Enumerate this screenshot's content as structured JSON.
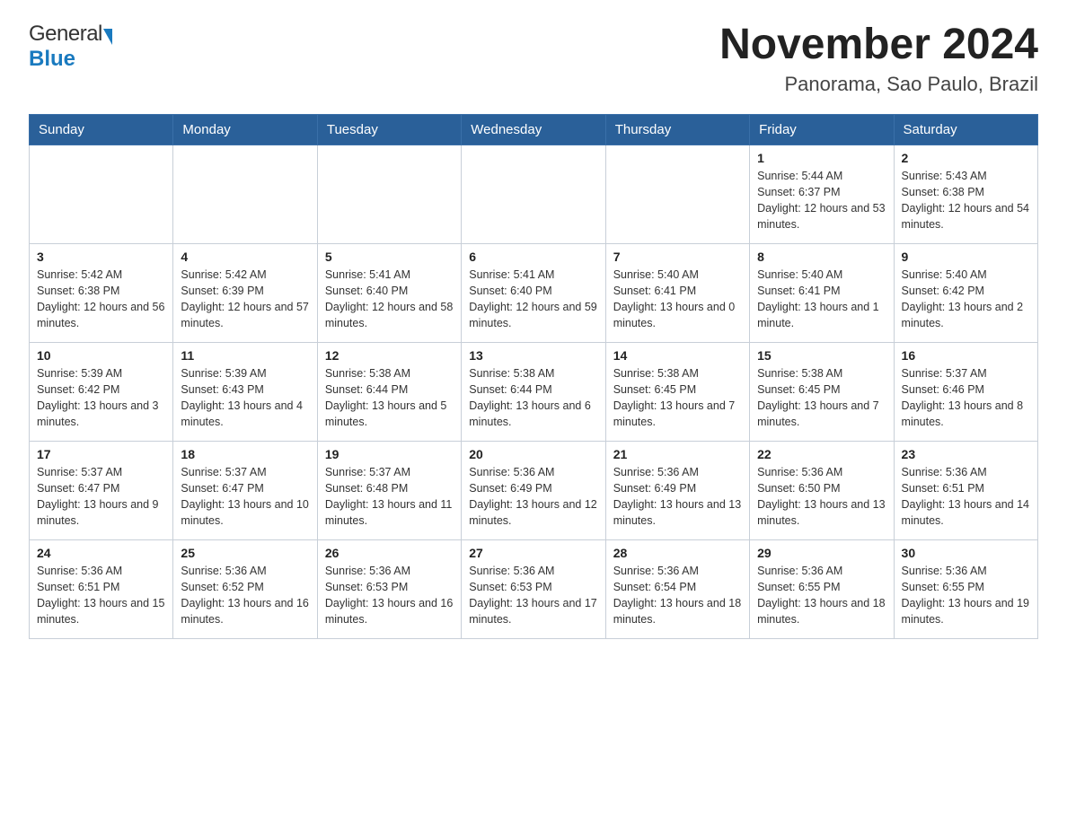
{
  "header": {
    "logo_general": "General",
    "logo_blue": "Blue",
    "title": "November 2024",
    "subtitle": "Panorama, Sao Paulo, Brazil"
  },
  "days_of_week": [
    "Sunday",
    "Monday",
    "Tuesday",
    "Wednesday",
    "Thursday",
    "Friday",
    "Saturday"
  ],
  "weeks": [
    [
      {
        "day": "",
        "info": ""
      },
      {
        "day": "",
        "info": ""
      },
      {
        "day": "",
        "info": ""
      },
      {
        "day": "",
        "info": ""
      },
      {
        "day": "",
        "info": ""
      },
      {
        "day": "1",
        "info": "Sunrise: 5:44 AM\nSunset: 6:37 PM\nDaylight: 12 hours and 53 minutes."
      },
      {
        "day": "2",
        "info": "Sunrise: 5:43 AM\nSunset: 6:38 PM\nDaylight: 12 hours and 54 minutes."
      }
    ],
    [
      {
        "day": "3",
        "info": "Sunrise: 5:42 AM\nSunset: 6:38 PM\nDaylight: 12 hours and 56 minutes."
      },
      {
        "day": "4",
        "info": "Sunrise: 5:42 AM\nSunset: 6:39 PM\nDaylight: 12 hours and 57 minutes."
      },
      {
        "day": "5",
        "info": "Sunrise: 5:41 AM\nSunset: 6:40 PM\nDaylight: 12 hours and 58 minutes."
      },
      {
        "day": "6",
        "info": "Sunrise: 5:41 AM\nSunset: 6:40 PM\nDaylight: 12 hours and 59 minutes."
      },
      {
        "day": "7",
        "info": "Sunrise: 5:40 AM\nSunset: 6:41 PM\nDaylight: 13 hours and 0 minutes."
      },
      {
        "day": "8",
        "info": "Sunrise: 5:40 AM\nSunset: 6:41 PM\nDaylight: 13 hours and 1 minute."
      },
      {
        "day": "9",
        "info": "Sunrise: 5:40 AM\nSunset: 6:42 PM\nDaylight: 13 hours and 2 minutes."
      }
    ],
    [
      {
        "day": "10",
        "info": "Sunrise: 5:39 AM\nSunset: 6:42 PM\nDaylight: 13 hours and 3 minutes."
      },
      {
        "day": "11",
        "info": "Sunrise: 5:39 AM\nSunset: 6:43 PM\nDaylight: 13 hours and 4 minutes."
      },
      {
        "day": "12",
        "info": "Sunrise: 5:38 AM\nSunset: 6:44 PM\nDaylight: 13 hours and 5 minutes."
      },
      {
        "day": "13",
        "info": "Sunrise: 5:38 AM\nSunset: 6:44 PM\nDaylight: 13 hours and 6 minutes."
      },
      {
        "day": "14",
        "info": "Sunrise: 5:38 AM\nSunset: 6:45 PM\nDaylight: 13 hours and 7 minutes."
      },
      {
        "day": "15",
        "info": "Sunrise: 5:38 AM\nSunset: 6:45 PM\nDaylight: 13 hours and 7 minutes."
      },
      {
        "day": "16",
        "info": "Sunrise: 5:37 AM\nSunset: 6:46 PM\nDaylight: 13 hours and 8 minutes."
      }
    ],
    [
      {
        "day": "17",
        "info": "Sunrise: 5:37 AM\nSunset: 6:47 PM\nDaylight: 13 hours and 9 minutes."
      },
      {
        "day": "18",
        "info": "Sunrise: 5:37 AM\nSunset: 6:47 PM\nDaylight: 13 hours and 10 minutes."
      },
      {
        "day": "19",
        "info": "Sunrise: 5:37 AM\nSunset: 6:48 PM\nDaylight: 13 hours and 11 minutes."
      },
      {
        "day": "20",
        "info": "Sunrise: 5:36 AM\nSunset: 6:49 PM\nDaylight: 13 hours and 12 minutes."
      },
      {
        "day": "21",
        "info": "Sunrise: 5:36 AM\nSunset: 6:49 PM\nDaylight: 13 hours and 13 minutes."
      },
      {
        "day": "22",
        "info": "Sunrise: 5:36 AM\nSunset: 6:50 PM\nDaylight: 13 hours and 13 minutes."
      },
      {
        "day": "23",
        "info": "Sunrise: 5:36 AM\nSunset: 6:51 PM\nDaylight: 13 hours and 14 minutes."
      }
    ],
    [
      {
        "day": "24",
        "info": "Sunrise: 5:36 AM\nSunset: 6:51 PM\nDaylight: 13 hours and 15 minutes."
      },
      {
        "day": "25",
        "info": "Sunrise: 5:36 AM\nSunset: 6:52 PM\nDaylight: 13 hours and 16 minutes."
      },
      {
        "day": "26",
        "info": "Sunrise: 5:36 AM\nSunset: 6:53 PM\nDaylight: 13 hours and 16 minutes."
      },
      {
        "day": "27",
        "info": "Sunrise: 5:36 AM\nSunset: 6:53 PM\nDaylight: 13 hours and 17 minutes."
      },
      {
        "day": "28",
        "info": "Sunrise: 5:36 AM\nSunset: 6:54 PM\nDaylight: 13 hours and 18 minutes."
      },
      {
        "day": "29",
        "info": "Sunrise: 5:36 AM\nSunset: 6:55 PM\nDaylight: 13 hours and 18 minutes."
      },
      {
        "day": "30",
        "info": "Sunrise: 5:36 AM\nSunset: 6:55 PM\nDaylight: 13 hours and 19 minutes."
      }
    ]
  ]
}
